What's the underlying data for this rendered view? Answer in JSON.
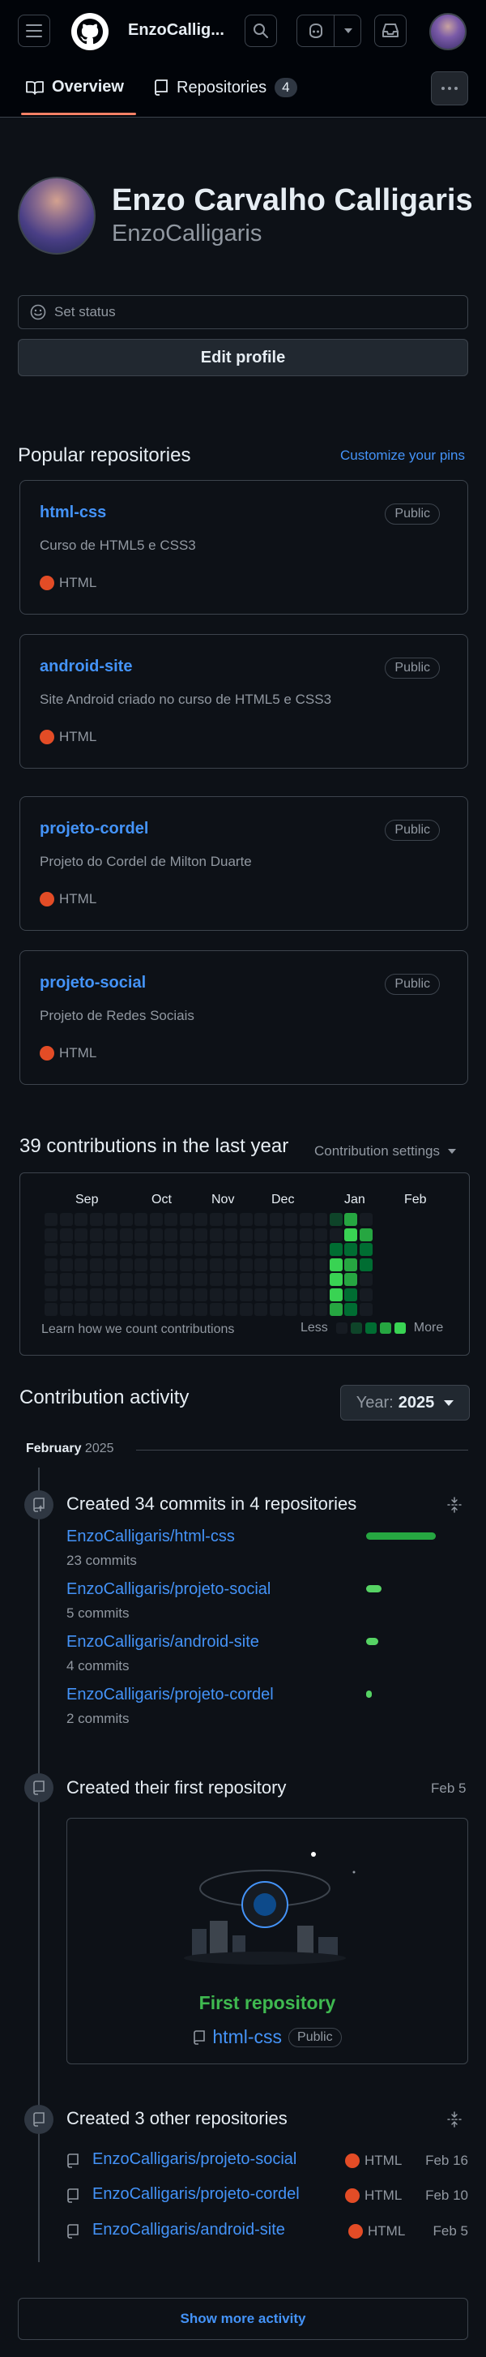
{
  "header": {
    "username": "EnzoCallig...",
    "tabs": [
      {
        "label": "Overview"
      },
      {
        "label": "Repositories",
        "count": "4"
      }
    ]
  },
  "profile": {
    "name": "Enzo Carvalho Calligaris",
    "login": "EnzoCalligaris",
    "set_status": "Set status",
    "edit_profile": "Edit profile"
  },
  "popular": {
    "heading": "Popular repositories",
    "customize": "Customize your pins",
    "repos": [
      {
        "name": "html-css",
        "visibility": "Public",
        "description": "Curso de HTML5 e CSS3",
        "language": "HTML"
      },
      {
        "name": "android-site",
        "visibility": "Public",
        "description": "Site Android criado no curso de HTML5 e CSS3",
        "language": "HTML"
      },
      {
        "name": "projeto-cordel",
        "visibility": "Public",
        "description": "Projeto do Cordel de Milton Duarte",
        "language": "HTML"
      },
      {
        "name": "projeto-social",
        "visibility": "Public",
        "description": "Projeto de Redes Sociais",
        "language": "HTML"
      }
    ],
    "language_color": "#e34c26"
  },
  "contributions": {
    "heading": "39 contributions in the last year",
    "settings": "Contribution settings",
    "months": [
      "Sep",
      "Oct",
      "Nov",
      "Dec",
      "Jan",
      "Feb"
    ],
    "learn": "Learn how we count contributions",
    "less": "Less",
    "more": "More",
    "level_colors": [
      "#161b22",
      "#0e4429",
      "#006d32",
      "#26a641",
      "#39d353"
    ]
  },
  "activity": {
    "heading": "Contribution activity",
    "year_label": "Year:",
    "year": "2025",
    "month": "February",
    "month_year": "2025",
    "commits_title": "Created 34 commits in 4 repositories",
    "commit_repos": [
      {
        "name": "EnzoCalligaris/html-css",
        "commits": "23 commits",
        "count": 23
      },
      {
        "name": "EnzoCalligaris/projeto-social",
        "commits": "5 commits",
        "count": 5
      },
      {
        "name": "EnzoCalligaris/android-site",
        "commits": "4 commits",
        "count": 4
      },
      {
        "name": "EnzoCalligaris/projeto-cordel",
        "commits": "2 commits",
        "count": 2
      }
    ],
    "first_repo_title": "Created their first repository",
    "first_repo_date": "Feb 5",
    "first_repo_label": "First repository",
    "first_repo_name": "html-css",
    "first_repo_visibility": "Public",
    "other_title": "Created 3 other repositories",
    "other_repos": [
      {
        "name": "EnzoCalligaris/projeto-social",
        "language": "HTML",
        "date": "Feb 16"
      },
      {
        "name": "EnzoCalligaris/projeto-cordel",
        "language": "HTML",
        "date": "Feb 10"
      },
      {
        "name": "EnzoCalligaris/android-site",
        "language": "HTML",
        "date": "Feb 5"
      }
    ],
    "show_more": "Show more activity"
  }
}
